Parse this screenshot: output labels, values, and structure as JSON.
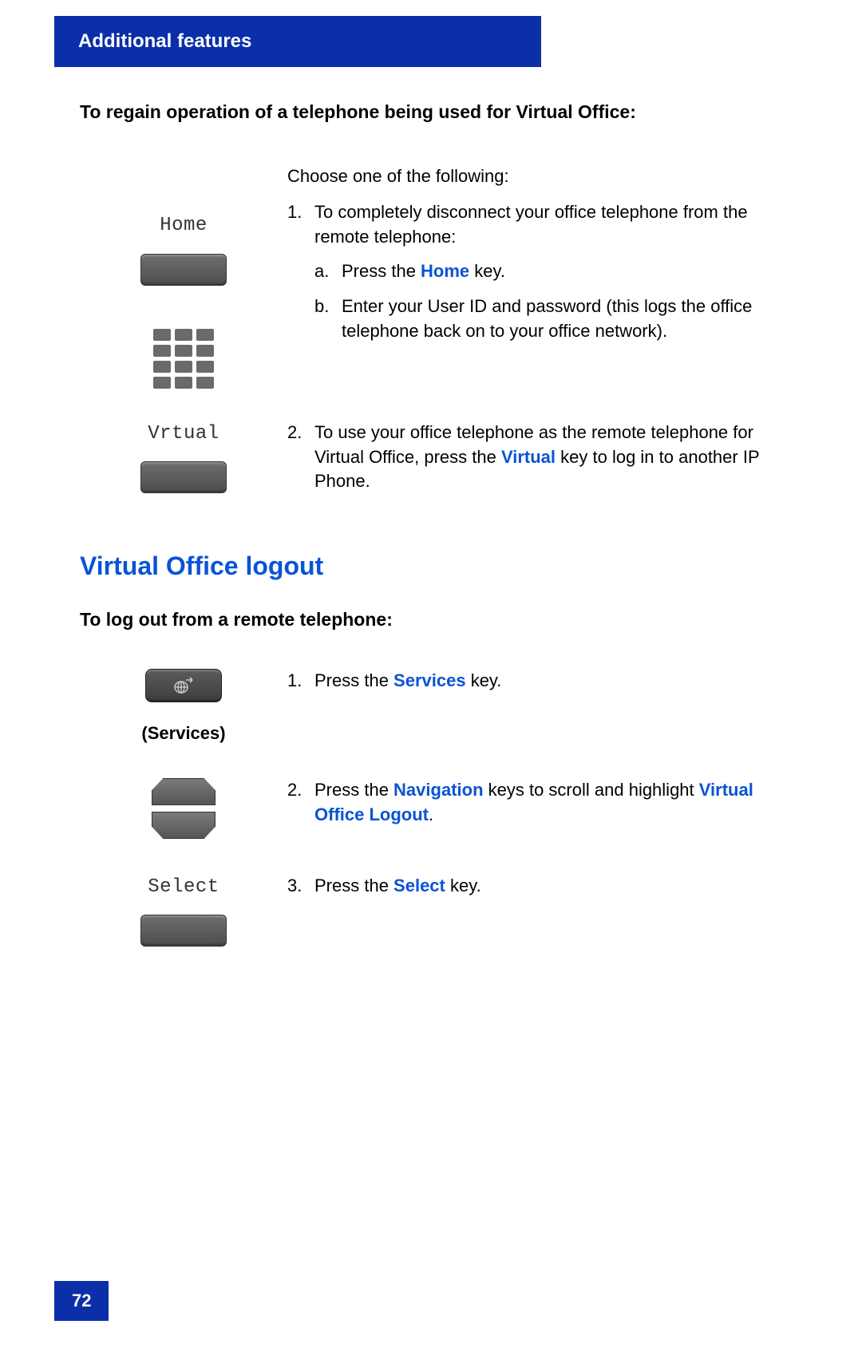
{
  "header": "Additional features",
  "page_number": "72",
  "section1": {
    "task": "To regain operation of a telephone being used for Virtual Office:",
    "intro": "Choose one of the following:",
    "softkey_home_label": "Home",
    "softkey_vrtual_label": "Vrtual",
    "step1_intro": "To completely disconnect your office telephone from the remote telephone:",
    "step1a_pre": "Press the ",
    "step1a_kw": "Home",
    "step1a_post": " key.",
    "step1b": "Enter your User ID and password (this logs the office telephone back on to your office network).",
    "step2_pre": "To use your office telephone as the remote telephone for Virtual Office, press the ",
    "step2_kw": "Virtual",
    "step2_post": " key to log in to another IP Phone.",
    "n1": "1.",
    "n2": "2.",
    "la": "a.",
    "lb": "b."
  },
  "section2": {
    "heading": "Virtual Office logout",
    "task": "To log out from a remote telephone:",
    "services_label": "(Services)",
    "select_label": "Select",
    "n1": "1.",
    "n2": "2.",
    "n3": "3.",
    "s1_pre": "Press the ",
    "s1_kw": "Services",
    "s1_post": " key.",
    "s2_pre": "Press the ",
    "s2_kw1": "Navigation",
    "s2_mid": " keys to scroll and highlight ",
    "s2_kw2": "Virtual Office Logout",
    "s2_post": ".",
    "s3_pre": "Press the ",
    "s3_kw": "Select",
    "s3_post": " key."
  }
}
